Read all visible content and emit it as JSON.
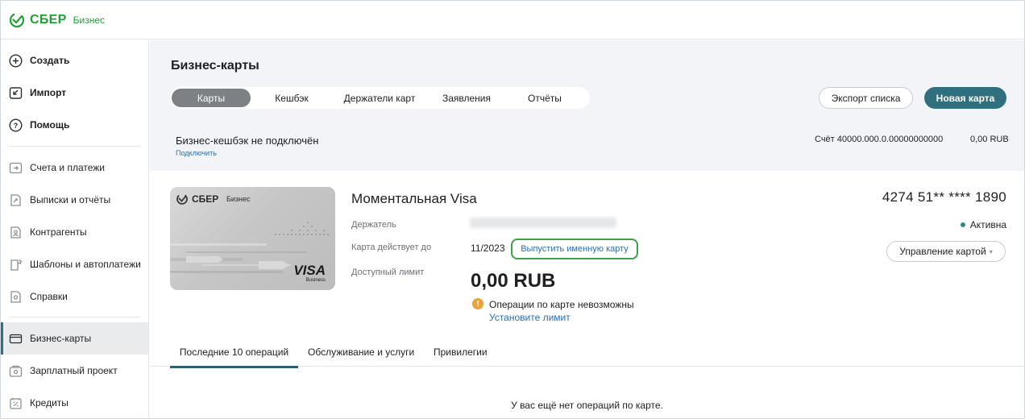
{
  "brand": {
    "name": "СБЕР",
    "sub": "Бизнес",
    "color": "#21a038"
  },
  "sidebar": {
    "actions": [
      {
        "label": "Создать",
        "icon": "plus-circle-icon"
      },
      {
        "label": "Импорт",
        "icon": "import-icon"
      },
      {
        "label": "Помощь",
        "icon": "help-circle-icon"
      }
    ],
    "items": [
      {
        "label": "Счета и платежи",
        "icon": "accounts-icon"
      },
      {
        "label": "Выписки и отчёты",
        "icon": "statements-icon"
      },
      {
        "label": "Контрагенты",
        "icon": "contractors-icon"
      },
      {
        "label": "Шаблоны и автоплатежи",
        "icon": "templates-icon"
      },
      {
        "label": "Справки",
        "icon": "certificates-icon"
      },
      {
        "label": "Бизнес-карты",
        "icon": "card-icon",
        "active": true
      },
      {
        "label": "Зарплатный проект",
        "icon": "salary-icon"
      },
      {
        "label": "Кредиты",
        "icon": "credit-icon"
      }
    ]
  },
  "main": {
    "title": "Бизнес-карты",
    "tabs": [
      {
        "label": "Карты",
        "active": true
      },
      {
        "label": "Кешбэк"
      },
      {
        "label": "Держатели карт"
      },
      {
        "label": "Заявления"
      },
      {
        "label": "Отчёты"
      }
    ],
    "export_label": "Экспорт списка",
    "new_card_label": "Новая карта",
    "cashback": {
      "title": "Бизнес-кешбэк не подключён",
      "link": "Подключить"
    },
    "account": {
      "label": "Счёт  40000.000.0.00000000000",
      "amount": "0,00 RUB"
    },
    "card": {
      "brand_text": "СБЕР",
      "brand_sub": "Бизнес",
      "network": "VISA",
      "network_sub": "Business",
      "title": "Моментальная Visa",
      "holder_label": "Держатель",
      "valid_label": "Карта действует до",
      "valid_value": "11/2023",
      "issue_named": "Выпустить именную карту",
      "limit_label": "Доступный лимит",
      "limit_value": "0,00 RUB",
      "warning_text": "Операции по карте невозможны",
      "warning_link": "Установите лимит",
      "number": "4274 51** **** 1890",
      "status": "Активна",
      "manage_label": "Управление картой"
    },
    "subtabs": [
      {
        "label": "Последние 10 операций",
        "active": true
      },
      {
        "label": "Обслуживание и услуги"
      },
      {
        "label": "Привилегии"
      }
    ],
    "empty_message": "У вас ещё нет операций по карте."
  }
}
